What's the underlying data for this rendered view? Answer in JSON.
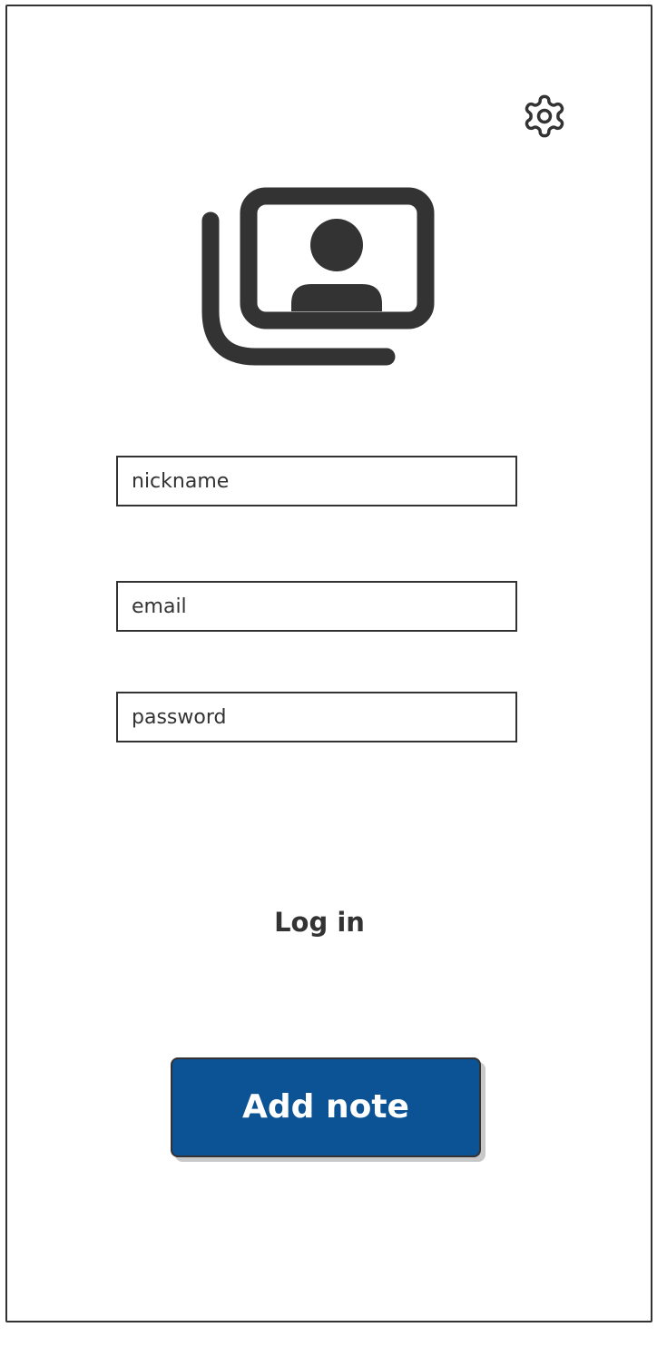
{
  "header": {
    "settings_icon": "gear-icon"
  },
  "profile": {
    "icon": "profile-photos-icon"
  },
  "form": {
    "nickname_placeholder": "nickname",
    "email_placeholder": "email",
    "password_placeholder": "password"
  },
  "actions": {
    "login_label": "Log in",
    "add_note_label": "Add note"
  },
  "colors": {
    "primary_button": "#0b5394",
    "stroke": "#333333",
    "background": "#ffffff"
  }
}
